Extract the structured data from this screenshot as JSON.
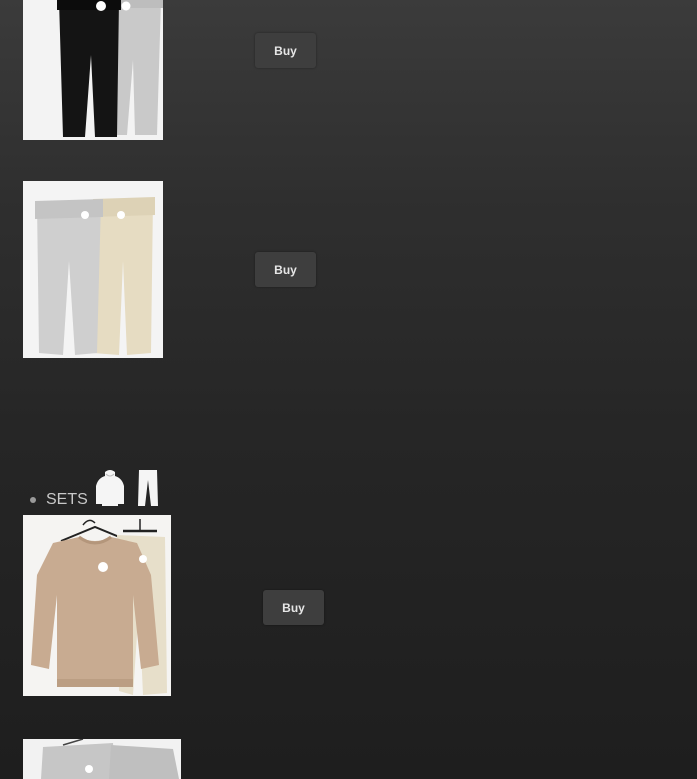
{
  "products": [
    {
      "id": "joggers-black-grey",
      "buy_label": "Buy"
    },
    {
      "id": "joggers-grey-cream",
      "buy_label": "Buy"
    },
    {
      "id": "set-tan-sweatshirt",
      "buy_label": "Buy"
    },
    {
      "id": "set-grey-partial"
    }
  ],
  "sections": {
    "sets": {
      "label": "SETS",
      "icons": [
        "hoodie-icon",
        "trousers-icon"
      ]
    }
  },
  "colors": {
    "background_top": "#3b3b3b",
    "background_bottom": "#1e1e1e",
    "button_bg": "#3e3e3e",
    "button_text": "#e6e6e6"
  }
}
